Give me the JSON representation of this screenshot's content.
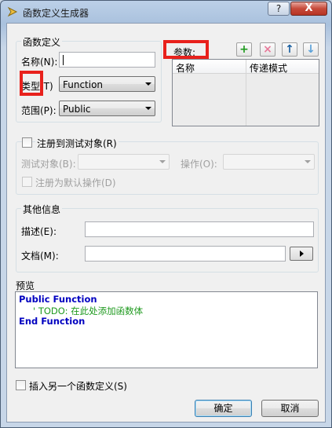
{
  "window": {
    "title": "函数定义生成器",
    "help_label": "?",
    "close_label": "X"
  },
  "definition": {
    "group_title": "函数定义",
    "name_label": "名称(N):",
    "name_value": "",
    "type_label": "类型(T)",
    "type_value": "Function",
    "scope_label": "范围(P):",
    "scope_value": "Public"
  },
  "params": {
    "label": "参数:",
    "toolbar": {
      "add": "+",
      "remove": "×",
      "up": "↑",
      "down": "↓"
    },
    "columns": [
      "名称",
      "传递模式"
    ]
  },
  "register": {
    "checkbox_label": "注册到测试对象(R)",
    "test_object_label": "测试对象(B):",
    "operation_label": "操作(O):",
    "default_label": "注册为默认操作(D)"
  },
  "other": {
    "group_title": "其他信息",
    "desc_label": "描述(E):",
    "doc_label": "文档(M):"
  },
  "preview": {
    "label": "预览",
    "line1": "Public Function",
    "line2": "' TODO: 在此处添加函数体",
    "line3": "End Function"
  },
  "footer": {
    "insert_label": "插入另一个函数定义(S)",
    "ok_label": "确定",
    "cancel_label": "取消"
  },
  "colors": {
    "highlight": "#e8211c",
    "keyword": "#0000c0",
    "comment": "#1f9a1f"
  }
}
